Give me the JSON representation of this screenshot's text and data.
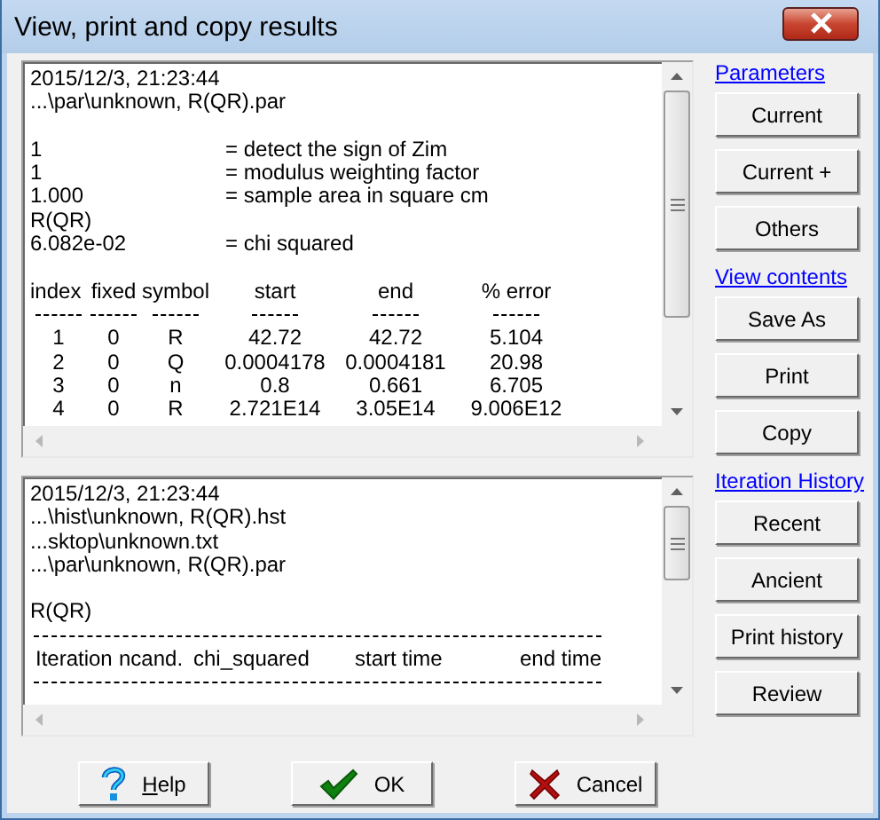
{
  "window": {
    "title": "View, print and copy results"
  },
  "results_panel": {
    "header_lines": [
      "2015/12/3, 21:23:44",
      "...\\par\\unknown, R(QR).par"
    ],
    "settings": [
      {
        "value": "1",
        "description": "= detect the sign of Zim"
      },
      {
        "value": "1",
        "description": "= modulus weighting factor"
      },
      {
        "value": "1.000",
        "description": "= sample area in square cm"
      }
    ],
    "model": "R(QR)",
    "fit": {
      "value": "6.082e-02",
      "description": "= chi squared"
    },
    "table": {
      "columns": [
        "index",
        "fixed",
        "symbol",
        "start",
        "end",
        "% error"
      ],
      "rows": [
        [
          "1",
          "0",
          "R",
          "42.72",
          "42.72",
          "5.104"
        ],
        [
          "2",
          "0",
          "Q",
          "0.0004178",
          "0.0004181",
          "20.98"
        ],
        [
          "3",
          "0",
          "n",
          "0.8",
          "0.661",
          "6.705"
        ],
        [
          "4",
          "0",
          "R",
          "2.721E14",
          "3.05E14",
          "9.006E12"
        ]
      ]
    }
  },
  "history_panel": {
    "lines": [
      "2015/12/3, 21:23:44",
      "...\\hist\\unknown, R(QR).hst",
      "...sktop\\unknown.txt",
      "...\\par\\unknown, R(QR).par"
    ],
    "model": "R(QR)",
    "columns": [
      "Iteration",
      "ncand.",
      "chi_squared",
      "start time",
      "end time"
    ]
  },
  "sidebar": {
    "sections": [
      {
        "title": "Parameters",
        "buttons": [
          "Current",
          "Current +",
          "Others"
        ]
      },
      {
        "title": "View contents",
        "buttons": [
          "Save As",
          "Print",
          "Copy"
        ]
      },
      {
        "title": "Iteration History",
        "buttons": [
          "Recent",
          "Ancient",
          "Print history",
          "Review"
        ]
      }
    ]
  },
  "buttons": [
    {
      "kind": "help",
      "accel": "H",
      "label": "elp"
    },
    {
      "kind": "ok",
      "label": "OK"
    },
    {
      "kind": "cancel",
      "label": "Cancel"
    }
  ]
}
